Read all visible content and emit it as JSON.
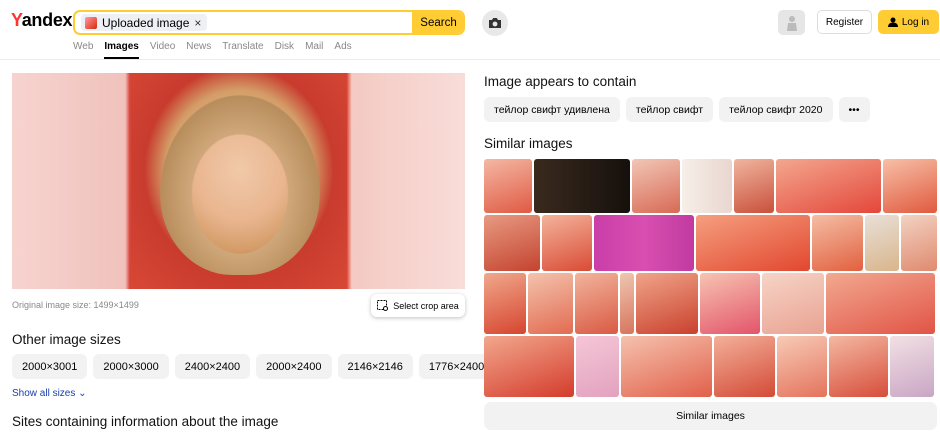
{
  "header": {
    "logo_first": "Y",
    "logo_rest": "andex",
    "search_chip": "Uploaded image",
    "search_chip_close": "×",
    "search_button": "Search",
    "tabs": [
      "Web",
      "Images",
      "Video",
      "News",
      "Translate",
      "Disk",
      "Mail",
      "Ads"
    ],
    "active_tab": "Images",
    "register": "Register",
    "login": "Log in"
  },
  "main": {
    "original_size": "Original image size: 1499×1499",
    "crop_label": "Select crop area",
    "other_sizes_title": "Other image sizes",
    "sizes": [
      "2000×3001",
      "2000×3000",
      "2400×2400",
      "2000×2400",
      "2146×2146",
      "1776×2400"
    ],
    "show_all": "Show all sizes",
    "sites_title": "Sites containing information about the image"
  },
  "right": {
    "contains_title": "Image appears to contain",
    "tags": [
      "тейлор свифт удивлена",
      "тейлор свифт",
      "тейлор свифт 2020"
    ],
    "more_label": "•••",
    "similar_title": "Similar images",
    "similar_button": "Similar images"
  },
  "colors": {
    "accent": "#ffcc33",
    "brand_red": "#ff3333",
    "link": "#1a3eab"
  }
}
